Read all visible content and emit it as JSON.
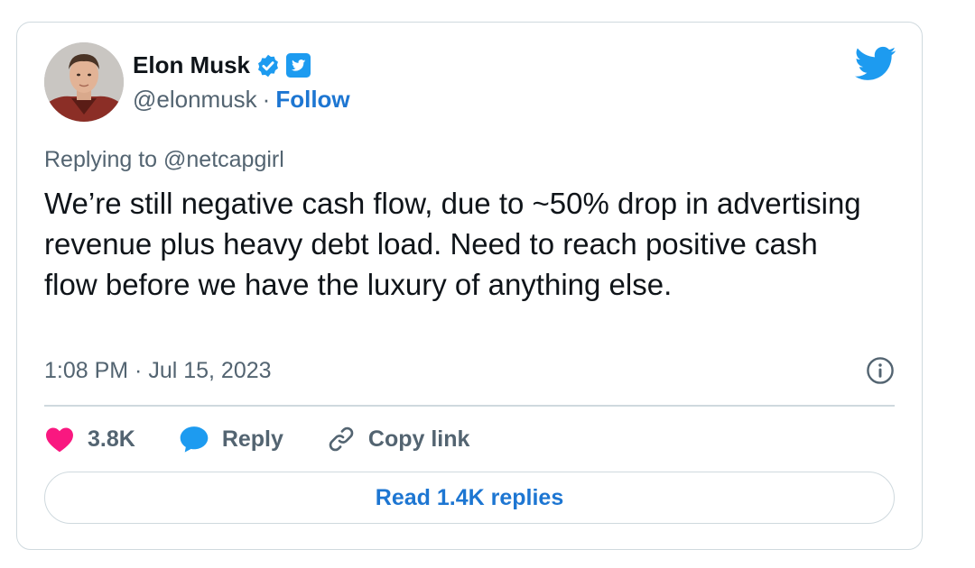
{
  "author": {
    "name": "Elon Musk",
    "handle": "@elonmusk",
    "separator": "·",
    "follow_label": "Follow"
  },
  "reply_context": "Replying to @netcapgirl",
  "tweet": {
    "text": "We’re still negative cash flow, due to ~50% drop in advertising revenue plus heavy debt load. Need to reach positive cash flow before we have the luxury of anything else.",
    "timestamp": "1:08 PM · Jul 15, 2023"
  },
  "actions": {
    "like_count": "3.8K",
    "reply_label": "Reply",
    "copy_link_label": "Copy link"
  },
  "read_replies_label": "Read 1.4K replies",
  "icons": {
    "verified": "verified-badge-icon",
    "twitter_square": "twitter-square-icon",
    "twitter_bird": "twitter-bird-icon",
    "info": "info-icon",
    "like": "heart-icon",
    "reply": "speech-bubble-icon",
    "link": "link-icon"
  },
  "colors": {
    "link_blue": "#1d76d2",
    "twitter_blue": "#1d9bf0",
    "heart": "#f91880",
    "muted_text": "#536471",
    "border": "#cfd9de"
  }
}
